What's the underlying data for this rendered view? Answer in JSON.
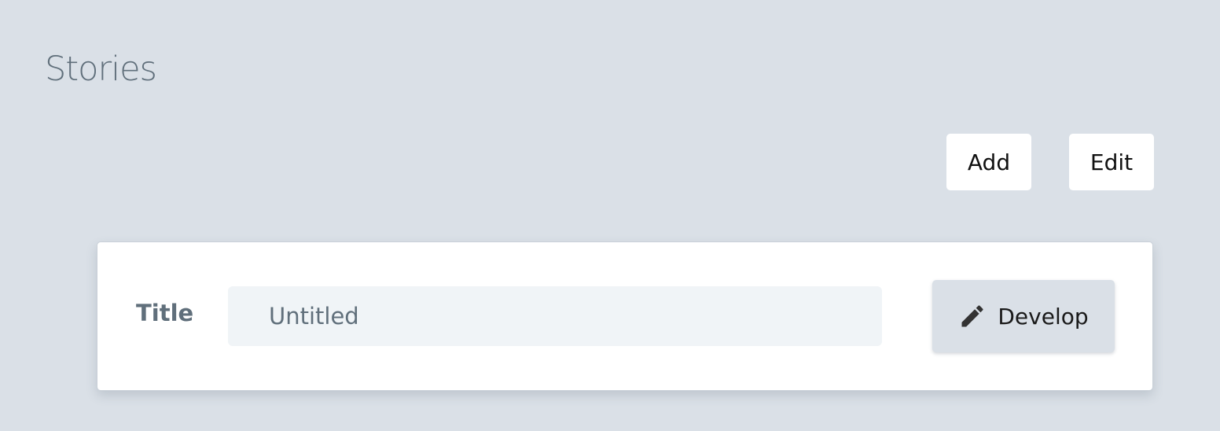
{
  "header": {
    "title": "Stories"
  },
  "toolbar": {
    "add_label": "Add",
    "edit_label": "Edit"
  },
  "story": {
    "title_label": "Title",
    "title_value": "Untitled",
    "develop_label": "Develop",
    "develop_icon": "pencil-icon"
  },
  "colors": {
    "background": "#dae0e7",
    "card": "#ffffff",
    "input_background": "#f0f4f7",
    "muted_text": "#606f7b"
  }
}
